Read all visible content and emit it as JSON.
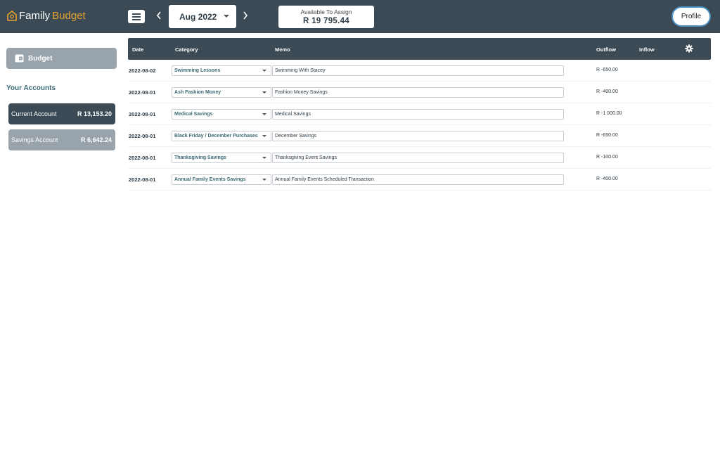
{
  "app": {
    "logo_family": "Family",
    "logo_budget": "Budget"
  },
  "topbar": {
    "prev_icon": "chevron-left-icon",
    "next_icon": "chevron-right-icon",
    "month": "Aug 2022",
    "assign_label": "Available To Assign",
    "assign_value": "R 19 795.44",
    "profile_label": "Profile"
  },
  "sidebar": {
    "budget_label": "Budget",
    "accounts_heading": "Your Accounts",
    "accounts": [
      {
        "name": "Current Account",
        "balance": "R 13,153.20"
      },
      {
        "name": "Savings Account",
        "balance": "R 6,642.24"
      }
    ]
  },
  "table": {
    "headers": {
      "date": "Date",
      "category": "Category",
      "memo": "Memo",
      "outflow": "Outflow",
      "inflow": "Inflow"
    },
    "rows": [
      {
        "date": "2022-08-02",
        "category": "Swimming Lessons",
        "memo": "Swimming With Stacey",
        "outflow": "R -650.00",
        "inflow": ""
      },
      {
        "date": "2022-08-01",
        "category": "Ash Fashion Money",
        "memo": "Fashion Money Savings",
        "outflow": "R -400.00",
        "inflow": ""
      },
      {
        "date": "2022-08-01",
        "category": "Medical Savings",
        "memo": "Medical Savings",
        "outflow": "R -1 000.00",
        "inflow": ""
      },
      {
        "date": "2022-08-01",
        "category": "Black Friday / December Purchases",
        "memo": "December Savings",
        "outflow": "R -650.00",
        "inflow": ""
      },
      {
        "date": "2022-08-01",
        "category": "Thanksgiving Savings",
        "memo": "Thanksgiving Event Savings",
        "outflow": "R -100.00",
        "inflow": ""
      },
      {
        "date": "2022-08-01",
        "category": "Annual Family Events Savings",
        "memo": "Annual Family Events Scheduled Transaction",
        "outflow": "R -400.00",
        "inflow": ""
      }
    ]
  },
  "colors": {
    "header_bg": "#3b4a54",
    "accent_gold": "#e6a12c",
    "muted_button": "#98a3ab",
    "teal_text": "#3d6a74",
    "profile_border": "#4a90c2"
  }
}
